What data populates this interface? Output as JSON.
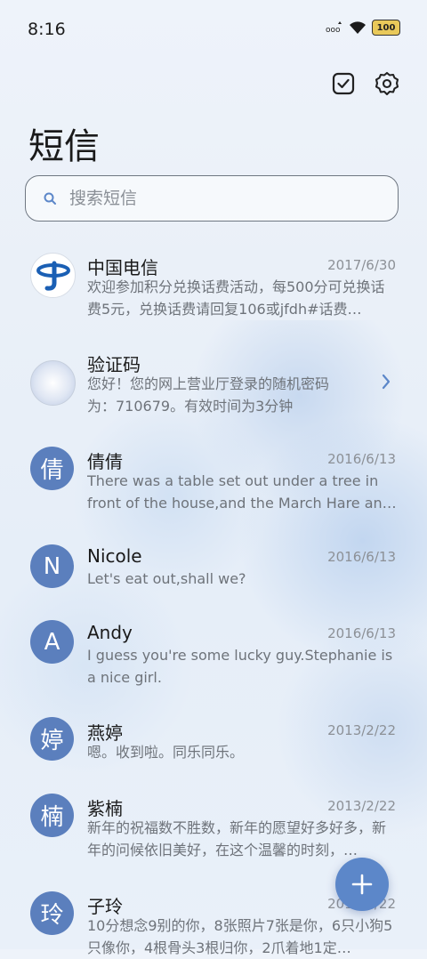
{
  "status_bar": {
    "time": "8:16",
    "battery": "100"
  },
  "header": {
    "title": "短信"
  },
  "search": {
    "placeholder": "搜索短信"
  },
  "conversations": [
    {
      "name": "中国电信",
      "date": "2017/6/30",
      "preview": "欢迎参加积分兑换话费活动，每500分可兑换话费5元，兑换话费请回复106或jfdh#话费…",
      "avatar": "china-telecom-logo"
    },
    {
      "name": "验证码",
      "date": "",
      "preview": "您好！您的网上营业厅登录的随机密码为：710679。有效时间为3分钟",
      "avatar": "porcelain-image"
    },
    {
      "name": "倩倩",
      "date": "2016/6/13",
      "preview": "There was a table set out under a tree in front of the house,and the March Hare an…",
      "avatar_text": "倩"
    },
    {
      "name": "Nicole",
      "date": "2016/6/13",
      "preview": "Let's eat out,shall we?",
      "avatar_text": "N"
    },
    {
      "name": "Andy",
      "date": "2016/6/13",
      "preview": "I guess you're some lucky guy.Stephanie is a nice girl.",
      "avatar_text": "A"
    },
    {
      "name": "燕婷",
      "date": "2013/2/22",
      "preview": "嗯。收到啦。同乐同乐。",
      "avatar_text": "婷"
    },
    {
      "name": "紫楠",
      "date": "2013/2/22",
      "preview": "新年的祝福数不胜数，新年的愿望好多好多，新年的问候依旧美好，在这个温馨的时刻，…",
      "avatar_text": "楠"
    },
    {
      "name": "子玲",
      "date": "2013/2/22",
      "preview": "10分想念9别的你，8张照片7张是你，6只小狗5只像你，4根骨头3根归你，2爪着地1定…",
      "avatar_text": "玲"
    }
  ],
  "colors": {
    "accent": "#5c87c9",
    "avatar": "#5b7fbd"
  },
  "icons": {
    "select": "checkbox-icon",
    "settings": "gear-icon",
    "search": "search-icon",
    "compose": "plus-icon"
  }
}
